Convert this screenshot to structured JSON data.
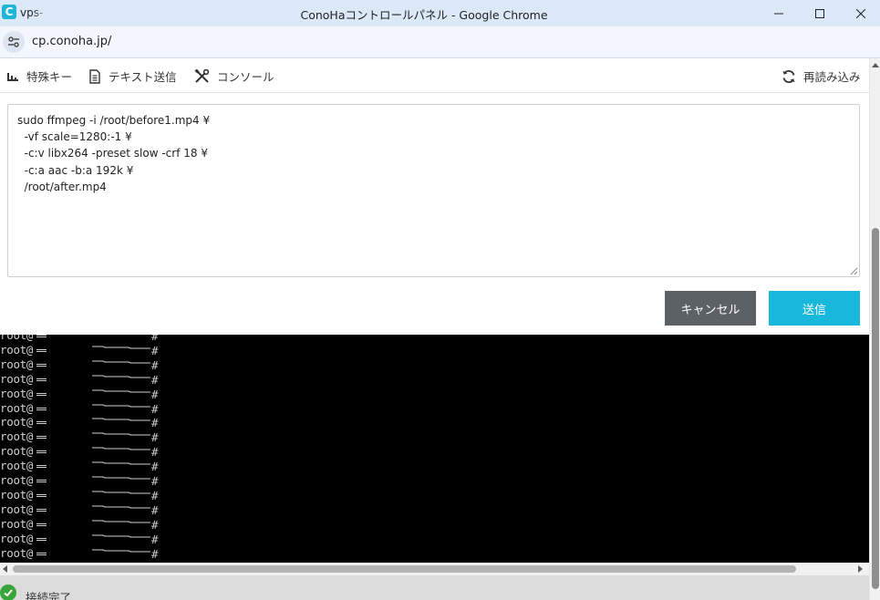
{
  "window": {
    "tab_title": "vps-",
    "title": "ConoHaコントロールパネル - Google Chrome",
    "app_icon_letter": "C"
  },
  "address": {
    "url": "cp.conoha.jp/"
  },
  "toolbar": {
    "special_keys": "特殊キー",
    "text_send": "テキスト送信",
    "console": "コンソール",
    "reload": "再読み込み"
  },
  "text_send": {
    "content": "sudo ffmpeg -i /root/before1.mp4 ¥\n  -vf scale=1280:-1 ¥\n  -c:v libx264 -preset slow -crf 18 ¥\n  -c:a aac -b:a 192k ¥\n  /root/after.mp4",
    "cancel_label": "キャンセル",
    "send_label": "送信"
  },
  "terminal": {
    "lines": [
      {
        "prefix": "root@",
        "hash": "#"
      },
      {
        "prefix": "root@",
        "hash": "#"
      },
      {
        "prefix": "root@",
        "hash": "#"
      },
      {
        "prefix": "root@",
        "hash": "#"
      },
      {
        "prefix": "root@",
        "hash": "#"
      },
      {
        "prefix": "root@",
        "hash": "#"
      },
      {
        "prefix": "root@",
        "hash": "#"
      },
      {
        "prefix": "root@",
        "hash": "#"
      },
      {
        "prefix": "root@",
        "hash": "#"
      },
      {
        "prefix": "root@",
        "hash": "#"
      },
      {
        "prefix": "root@",
        "hash": "#"
      },
      {
        "prefix": "root@",
        "hash": "#"
      },
      {
        "prefix": "root@",
        "hash": "#"
      },
      {
        "prefix": "root@",
        "hash": "#"
      },
      {
        "prefix": "root@",
        "hash": "#"
      },
      {
        "prefix": "root@",
        "hash": "#"
      }
    ]
  },
  "status": {
    "text": "接続完了"
  },
  "colors": {
    "send_button": "#17b8dc",
    "cancel_button": "#5c6165",
    "status_ok": "#37a53a",
    "terminal_bg": "#000000"
  }
}
